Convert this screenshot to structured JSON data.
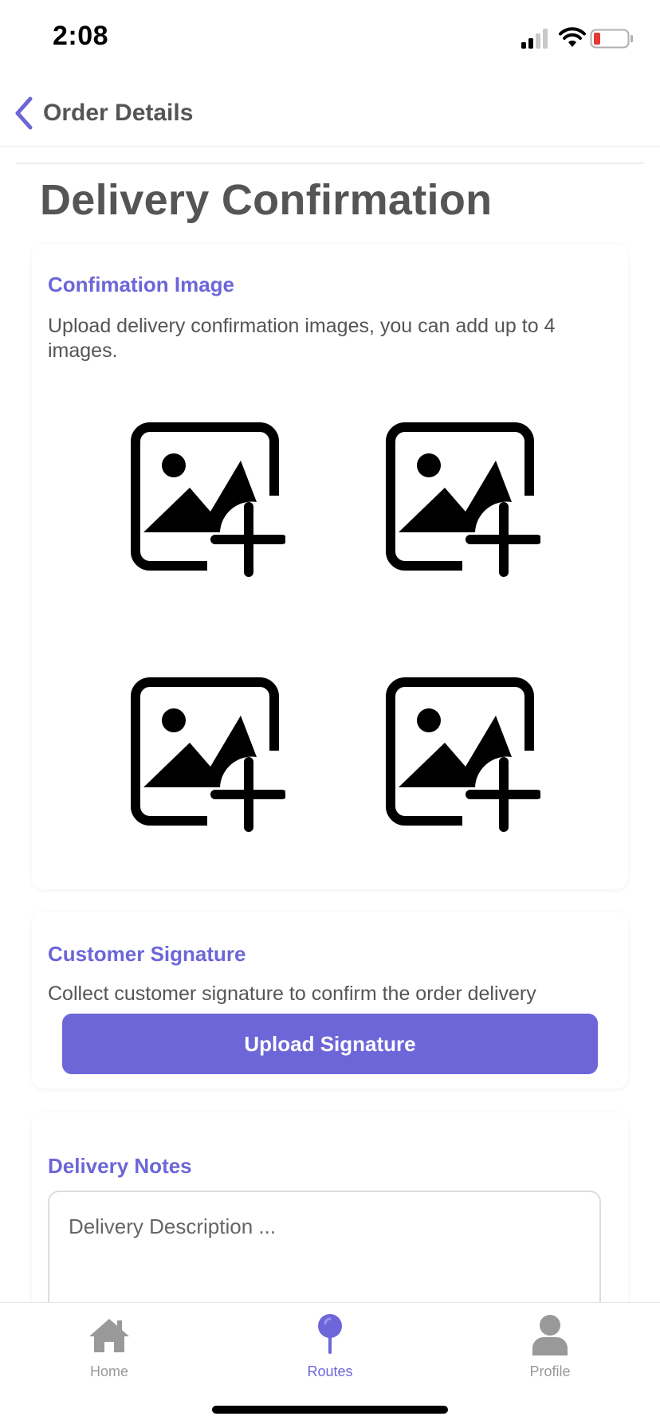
{
  "status_bar": {
    "time": "2:08",
    "battery_color": "#e53935"
  },
  "header": {
    "back_label": "Order Details"
  },
  "page": {
    "title": "Delivery Confirmation"
  },
  "confirmation_image": {
    "title": "Confimation Image",
    "description": "Upload delivery confirmation images, you can add up to 4 images.",
    "slots": [
      {
        "icon": "add-photo-icon"
      },
      {
        "icon": "add-photo-icon"
      },
      {
        "icon": "add-photo-icon"
      },
      {
        "icon": "add-photo-icon"
      }
    ]
  },
  "customer_signature": {
    "title": "Customer Signature",
    "description": "Collect customer signature to confirm the order delivery",
    "button_label": "Upload Signature"
  },
  "delivery_notes": {
    "title": "Delivery Notes",
    "placeholder": "Delivery Description ...",
    "value": ""
  },
  "tab_bar": {
    "tabs": [
      {
        "label": "Home",
        "icon": "home-icon",
        "active": false
      },
      {
        "label": "Routes",
        "icon": "map-pin-icon",
        "active": true
      },
      {
        "label": "Profile",
        "icon": "person-icon",
        "active": false
      }
    ],
    "active_color": "#6c66d8",
    "inactive_color": "#999999"
  },
  "theme": {
    "accent": "#6c66d8",
    "text": "#555555"
  }
}
